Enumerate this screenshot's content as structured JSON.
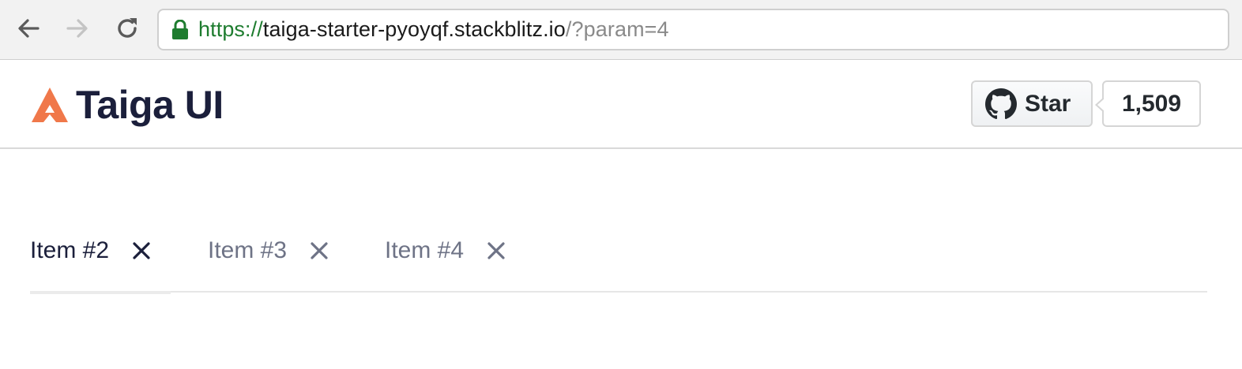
{
  "browser": {
    "url_scheme": "https://",
    "url_host": "taiga-starter-pyoyqf.stackblitz.io",
    "url_path": "/?param=4",
    "icons": {
      "back": "back-arrow-icon",
      "forward": "forward-arrow-icon",
      "reload": "reload-icon",
      "lock": "lock-icon"
    }
  },
  "header": {
    "logo_text": "Taiga UI",
    "logo_color": "#f0784a",
    "github": {
      "star_label": "Star",
      "star_count": "1,509",
      "icon": "github-icon"
    }
  },
  "tabs": [
    {
      "label": "Item #2",
      "active": true
    },
    {
      "label": "Item #3",
      "active": false
    },
    {
      "label": "Item #4",
      "active": false
    }
  ],
  "colors": {
    "accent": "#f0784a",
    "text_dark": "#1b1f3b",
    "text_muted": "#6e7386",
    "secure_green": "#1e7c2f"
  }
}
